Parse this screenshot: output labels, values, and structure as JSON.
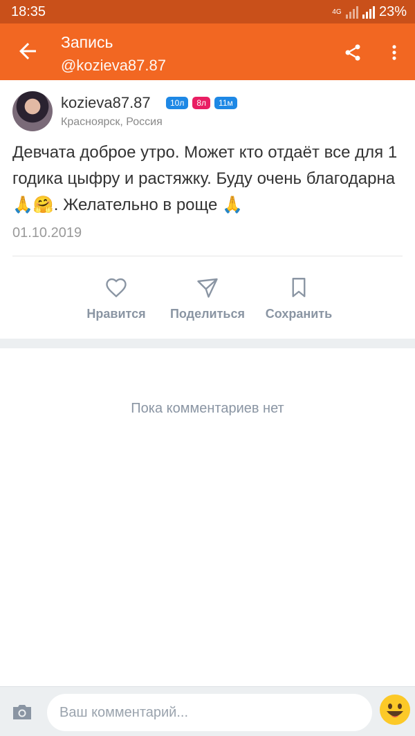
{
  "status_bar": {
    "time": "18:35",
    "network": "4G",
    "battery": "23%"
  },
  "toolbar": {
    "title": "Запись",
    "subtitle": "@kozieva87.87",
    "back_icon": "arrow-back-icon",
    "share_icon": "share-icon",
    "more_icon": "more-vert-icon"
  },
  "post": {
    "author": "kozieva87.87",
    "badges": [
      {
        "label": "10л",
        "color": "#1e88e5"
      },
      {
        "label": "8л",
        "color": "#e91e63"
      },
      {
        "label": "11м",
        "color": "#1e88e5"
      }
    ],
    "location": "Красноярск, Россия",
    "text": "Девчата доброе утро. Может кто отдаёт все для 1  годика цыфру и растяжку. Буду очень благодарна🙏🤗. Желательно в роще 🙏",
    "date": "01.10.2019"
  },
  "actions": {
    "like_label": "Нравится",
    "share_label": "Поделиться",
    "save_label": "Сохранить"
  },
  "comments": {
    "empty_text": "Пока комментариев нет"
  },
  "composer": {
    "placeholder": "Ваш комментарий...",
    "camera_icon": "camera-icon",
    "emoji_icon": "smiley-icon"
  },
  "colors": {
    "accent": "#f26722",
    "status_bar": "#c9501a"
  }
}
